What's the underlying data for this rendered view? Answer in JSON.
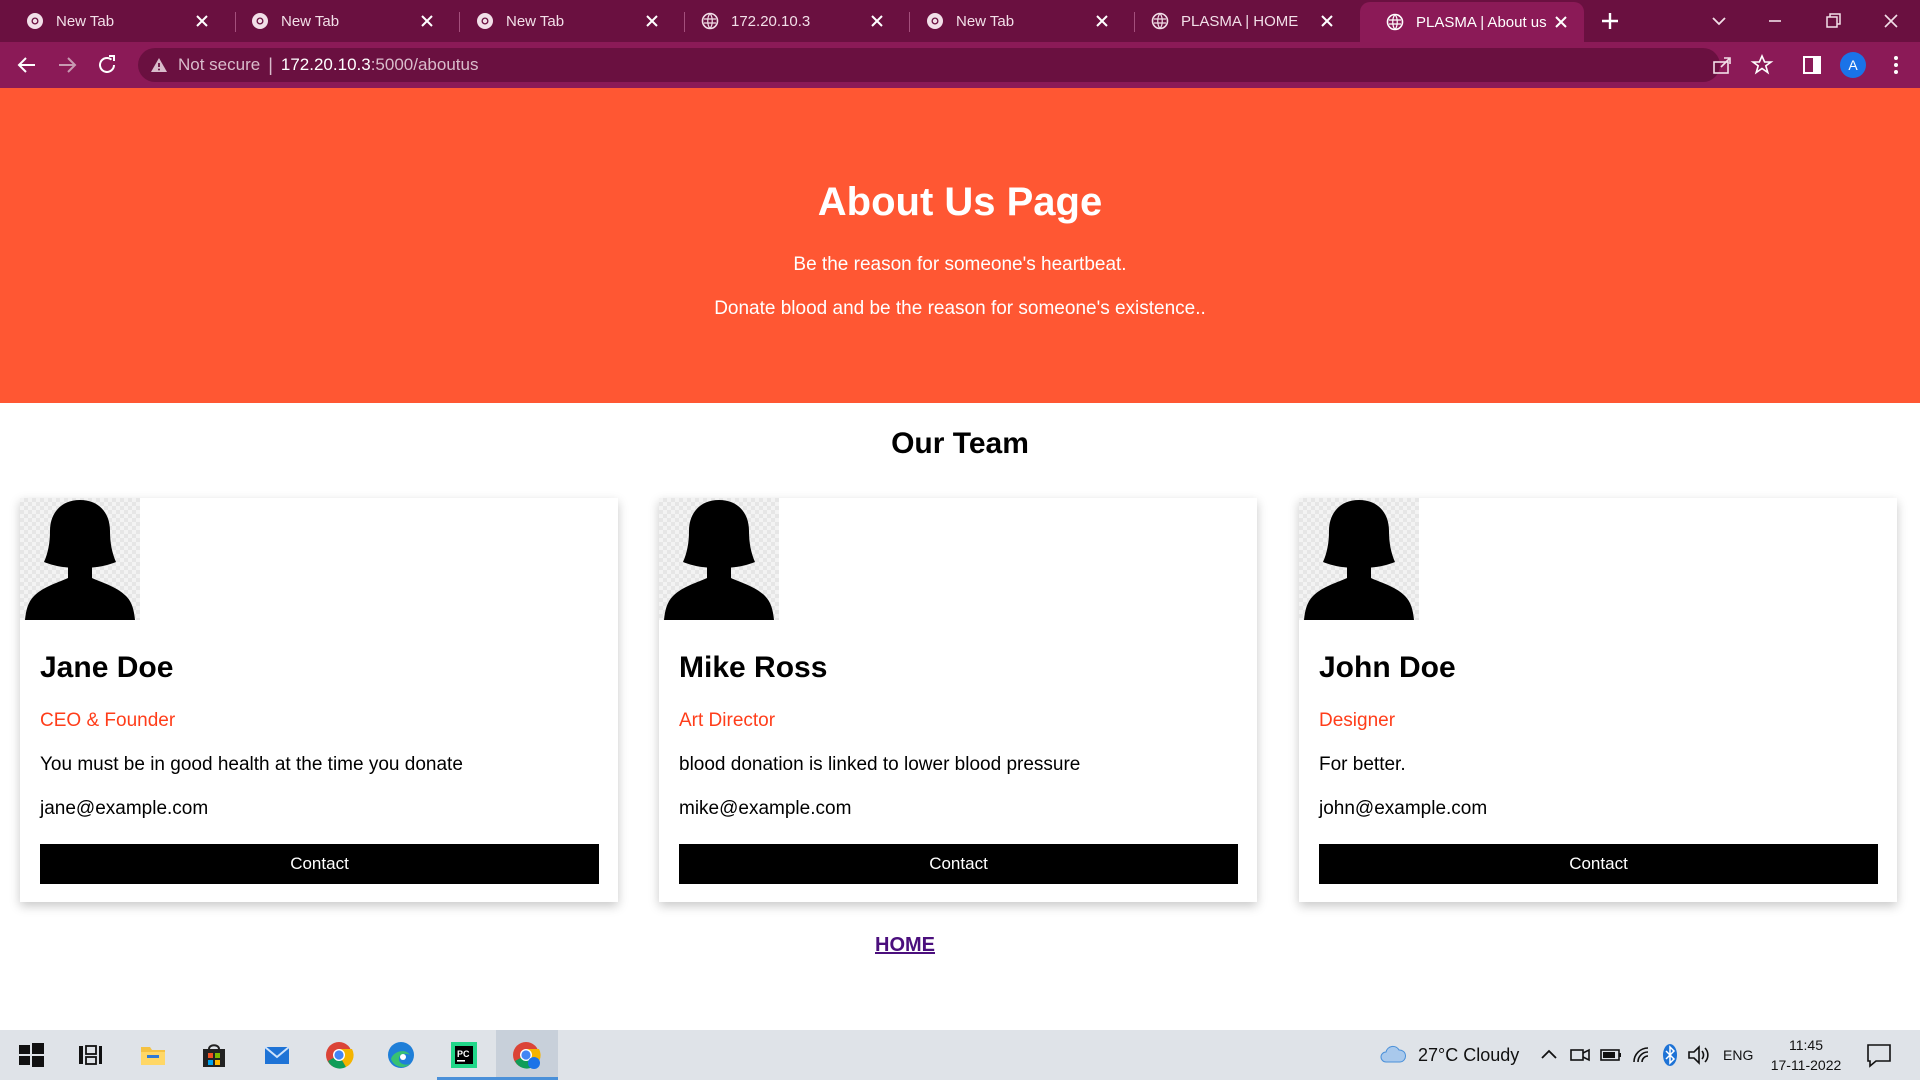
{
  "browser": {
    "tabs": [
      {
        "title": "New Tab",
        "favicon": "chrome-icon"
      },
      {
        "title": "New Tab",
        "favicon": "chrome-icon"
      },
      {
        "title": "New Tab",
        "favicon": "chrome-icon"
      },
      {
        "title": "172.20.10.3",
        "favicon": "globe-icon"
      },
      {
        "title": "New Tab",
        "favicon": "chrome-icon"
      },
      {
        "title": "PLASMA | HOME",
        "favicon": "globe-icon"
      },
      {
        "title": "PLASMA | About us",
        "favicon": "globe-icon",
        "active": true
      }
    ],
    "security_label": "Not secure",
    "url_host": "172.20.10.3",
    "url_path": ":5000/aboutus",
    "profile_initial": "A"
  },
  "hero": {
    "title": "About Us Page",
    "line1": "Be the reason for someone's heartbeat.",
    "line2": "Donate blood and be the reason for someone's existence.."
  },
  "team": {
    "title": "Our Team",
    "members": [
      {
        "name": "Jane Doe",
        "role": "CEO & Founder",
        "description": "You must be in good health at the time you donate",
        "email": "jane@example.com",
        "button": "Contact"
      },
      {
        "name": "Mike Ross",
        "role": "Art Director",
        "description": "blood donation is linked to lower blood pressure",
        "email": "mike@example.com",
        "button": "Contact"
      },
      {
        "name": "John Doe",
        "role": "Designer",
        "description": "For better.",
        "email": "john@example.com",
        "button": "Contact"
      }
    ]
  },
  "footer": {
    "home_link": "HOME"
  },
  "taskbar": {
    "weather": "27°C  Cloudy",
    "language": "ENG",
    "time": "11:45",
    "date": "17-11-2022"
  },
  "colors": {
    "hero_bg": "#ff5733",
    "role_text": "#ff3d1a",
    "browser_frame": "#8b1a57",
    "tab_strip": "#6a1040"
  }
}
